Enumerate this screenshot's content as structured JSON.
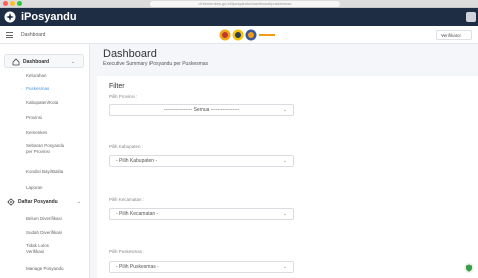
{
  "browser": {
    "url": "dl.kemenkes.go.id/iposyandu/dashboard/puskesmas"
  },
  "header": {
    "brand": "iPosyandu"
  },
  "topbar": {
    "breadcrumb": "Dashboard",
    "user_select": "Verifikator"
  },
  "sidebar": {
    "dashboard_label": "Dashboard",
    "dashboard_items": [
      "Kelurahan",
      "Puskesmas",
      "Kabupaten/Kota",
      "Provinsi",
      "Kemenkes",
      "Sebaran Posyandu per Provinsi",
      "Kondisi Bayi/Balita",
      "Laporan"
    ],
    "daftar_label": "Daftar Posyandu",
    "daftar_items": [
      "Belum Diverifikasi",
      "Sudah Diverifikasi",
      "Tidak Lolos Verifikasi",
      "Manage Posyandu"
    ]
  },
  "main": {
    "title": "Dashboard",
    "subtitle": "Executive Summary iPosyandu per Puskesmas",
    "filter_title": "Filter",
    "fields": [
      {
        "label": "Pilih Provinsi :",
        "value": "----------------- Semua -----------------"
      },
      {
        "label": "Pilih Kabupaten :",
        "value": "- Pilih Kabupaten -"
      },
      {
        "label": "Pilih Kecamatan :",
        "value": "- Pilih Kecamatan -"
      },
      {
        "label": "Pilih Puskesmas :",
        "value": "- Pilih Puskesmas -"
      }
    ]
  },
  "colors": {
    "header_bg": "#1f2d44",
    "accent": "#4a90e2"
  }
}
